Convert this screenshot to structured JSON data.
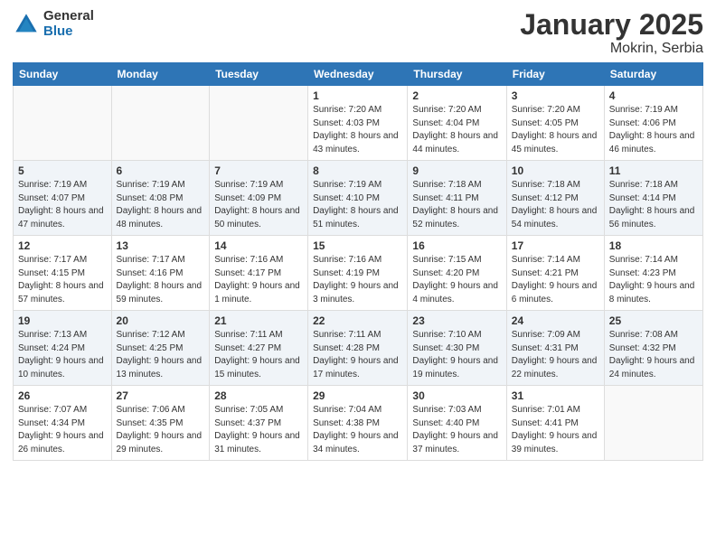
{
  "logo": {
    "general": "General",
    "blue": "Blue"
  },
  "title": "January 2025",
  "subtitle": "Mokrin, Serbia",
  "days_of_week": [
    "Sunday",
    "Monday",
    "Tuesday",
    "Wednesday",
    "Thursday",
    "Friday",
    "Saturday"
  ],
  "weeks": [
    [
      {
        "day": "",
        "sunrise": "",
        "sunset": "",
        "daylight": ""
      },
      {
        "day": "",
        "sunrise": "",
        "sunset": "",
        "daylight": ""
      },
      {
        "day": "",
        "sunrise": "",
        "sunset": "",
        "daylight": ""
      },
      {
        "day": "1",
        "sunrise": "Sunrise: 7:20 AM",
        "sunset": "Sunset: 4:03 PM",
        "daylight": "Daylight: 8 hours and 43 minutes."
      },
      {
        "day": "2",
        "sunrise": "Sunrise: 7:20 AM",
        "sunset": "Sunset: 4:04 PM",
        "daylight": "Daylight: 8 hours and 44 minutes."
      },
      {
        "day": "3",
        "sunrise": "Sunrise: 7:20 AM",
        "sunset": "Sunset: 4:05 PM",
        "daylight": "Daylight: 8 hours and 45 minutes."
      },
      {
        "day": "4",
        "sunrise": "Sunrise: 7:19 AM",
        "sunset": "Sunset: 4:06 PM",
        "daylight": "Daylight: 8 hours and 46 minutes."
      }
    ],
    [
      {
        "day": "5",
        "sunrise": "Sunrise: 7:19 AM",
        "sunset": "Sunset: 4:07 PM",
        "daylight": "Daylight: 8 hours and 47 minutes."
      },
      {
        "day": "6",
        "sunrise": "Sunrise: 7:19 AM",
        "sunset": "Sunset: 4:08 PM",
        "daylight": "Daylight: 8 hours and 48 minutes."
      },
      {
        "day": "7",
        "sunrise": "Sunrise: 7:19 AM",
        "sunset": "Sunset: 4:09 PM",
        "daylight": "Daylight: 8 hours and 50 minutes."
      },
      {
        "day": "8",
        "sunrise": "Sunrise: 7:19 AM",
        "sunset": "Sunset: 4:10 PM",
        "daylight": "Daylight: 8 hours and 51 minutes."
      },
      {
        "day": "9",
        "sunrise": "Sunrise: 7:18 AM",
        "sunset": "Sunset: 4:11 PM",
        "daylight": "Daylight: 8 hours and 52 minutes."
      },
      {
        "day": "10",
        "sunrise": "Sunrise: 7:18 AM",
        "sunset": "Sunset: 4:12 PM",
        "daylight": "Daylight: 8 hours and 54 minutes."
      },
      {
        "day": "11",
        "sunrise": "Sunrise: 7:18 AM",
        "sunset": "Sunset: 4:14 PM",
        "daylight": "Daylight: 8 hours and 56 minutes."
      }
    ],
    [
      {
        "day": "12",
        "sunrise": "Sunrise: 7:17 AM",
        "sunset": "Sunset: 4:15 PM",
        "daylight": "Daylight: 8 hours and 57 minutes."
      },
      {
        "day": "13",
        "sunrise": "Sunrise: 7:17 AM",
        "sunset": "Sunset: 4:16 PM",
        "daylight": "Daylight: 8 hours and 59 minutes."
      },
      {
        "day": "14",
        "sunrise": "Sunrise: 7:16 AM",
        "sunset": "Sunset: 4:17 PM",
        "daylight": "Daylight: 9 hours and 1 minute."
      },
      {
        "day": "15",
        "sunrise": "Sunrise: 7:16 AM",
        "sunset": "Sunset: 4:19 PM",
        "daylight": "Daylight: 9 hours and 3 minutes."
      },
      {
        "day": "16",
        "sunrise": "Sunrise: 7:15 AM",
        "sunset": "Sunset: 4:20 PM",
        "daylight": "Daylight: 9 hours and 4 minutes."
      },
      {
        "day": "17",
        "sunrise": "Sunrise: 7:14 AM",
        "sunset": "Sunset: 4:21 PM",
        "daylight": "Daylight: 9 hours and 6 minutes."
      },
      {
        "day": "18",
        "sunrise": "Sunrise: 7:14 AM",
        "sunset": "Sunset: 4:23 PM",
        "daylight": "Daylight: 9 hours and 8 minutes."
      }
    ],
    [
      {
        "day": "19",
        "sunrise": "Sunrise: 7:13 AM",
        "sunset": "Sunset: 4:24 PM",
        "daylight": "Daylight: 9 hours and 10 minutes."
      },
      {
        "day": "20",
        "sunrise": "Sunrise: 7:12 AM",
        "sunset": "Sunset: 4:25 PM",
        "daylight": "Daylight: 9 hours and 13 minutes."
      },
      {
        "day": "21",
        "sunrise": "Sunrise: 7:11 AM",
        "sunset": "Sunset: 4:27 PM",
        "daylight": "Daylight: 9 hours and 15 minutes."
      },
      {
        "day": "22",
        "sunrise": "Sunrise: 7:11 AM",
        "sunset": "Sunset: 4:28 PM",
        "daylight": "Daylight: 9 hours and 17 minutes."
      },
      {
        "day": "23",
        "sunrise": "Sunrise: 7:10 AM",
        "sunset": "Sunset: 4:30 PM",
        "daylight": "Daylight: 9 hours and 19 minutes."
      },
      {
        "day": "24",
        "sunrise": "Sunrise: 7:09 AM",
        "sunset": "Sunset: 4:31 PM",
        "daylight": "Daylight: 9 hours and 22 minutes."
      },
      {
        "day": "25",
        "sunrise": "Sunrise: 7:08 AM",
        "sunset": "Sunset: 4:32 PM",
        "daylight": "Daylight: 9 hours and 24 minutes."
      }
    ],
    [
      {
        "day": "26",
        "sunrise": "Sunrise: 7:07 AM",
        "sunset": "Sunset: 4:34 PM",
        "daylight": "Daylight: 9 hours and 26 minutes."
      },
      {
        "day": "27",
        "sunrise": "Sunrise: 7:06 AM",
        "sunset": "Sunset: 4:35 PM",
        "daylight": "Daylight: 9 hours and 29 minutes."
      },
      {
        "day": "28",
        "sunrise": "Sunrise: 7:05 AM",
        "sunset": "Sunset: 4:37 PM",
        "daylight": "Daylight: 9 hours and 31 minutes."
      },
      {
        "day": "29",
        "sunrise": "Sunrise: 7:04 AM",
        "sunset": "Sunset: 4:38 PM",
        "daylight": "Daylight: 9 hours and 34 minutes."
      },
      {
        "day": "30",
        "sunrise": "Sunrise: 7:03 AM",
        "sunset": "Sunset: 4:40 PM",
        "daylight": "Daylight: 9 hours and 37 minutes."
      },
      {
        "day": "31",
        "sunrise": "Sunrise: 7:01 AM",
        "sunset": "Sunset: 4:41 PM",
        "daylight": "Daylight: 9 hours and 39 minutes."
      },
      {
        "day": "",
        "sunrise": "",
        "sunset": "",
        "daylight": ""
      }
    ]
  ]
}
